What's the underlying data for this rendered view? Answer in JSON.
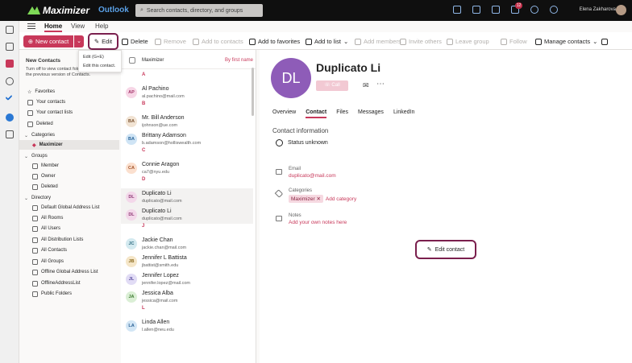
{
  "topbar": {
    "brand": "Maximizer",
    "app": "Outlook",
    "search_placeholder": "Search contacts, directory, and groups",
    "notification_count": "12",
    "user_name": "Elena Zakharova"
  },
  "menu": {
    "tabs": [
      "Home",
      "View",
      "Help"
    ]
  },
  "toolbar": {
    "new_contact": "New contact",
    "edit": "Edit",
    "delete": "Delete",
    "remove": "Remove",
    "add_to_contacts": "Add to contacts",
    "add_to_favorites": "Add to favorites",
    "add_to_list": "Add to list",
    "add_members": "Add members",
    "invite_others": "Invite others",
    "leave_group": "Leave group",
    "follow": "Follow",
    "manage_contacts": "Manage contacts"
  },
  "tooltip": {
    "shortcut": "Edit (G+E)",
    "desc": "Edit this contact."
  },
  "sidebar": {
    "new_contacts_title": "New Contacts",
    "new_contacts_desc": "Turn off to view contact folders in the previous version of Contacts.",
    "items": [
      "Favorites",
      "Your contacts",
      "Your contact lists",
      "Deleted"
    ],
    "categories_header": "Categories",
    "categories": [
      "Maximizer"
    ],
    "groups_header": "Groups",
    "groups": [
      "Member",
      "Owner",
      "Deleted"
    ],
    "directory_header": "Directory",
    "directory": [
      "Default Global Address List",
      "All Rooms",
      "All Users",
      "All Distribution Lists",
      "All Contacts",
      "All Groups",
      "Offline Global Address List",
      "OfflineAddressList",
      "Public Folders"
    ]
  },
  "list": {
    "header": "Maximizer",
    "sort": "By first name",
    "entries": [
      {
        "letter": "A"
      },
      {
        "initials": "AP",
        "name": "Al Pachino",
        "email": "al.pachino@mail.com",
        "color": "#f7d6e6",
        "fg": "#a4366b"
      },
      {
        "letter": "B"
      },
      {
        "initials": "BA",
        "name": "Mr. Bill Anderson",
        "email": "ijohnson@ue.com",
        "color": "#f1e3d3",
        "fg": "#7a5230"
      },
      {
        "initials": "BA",
        "name": "Brittany Adamson",
        "email": "b.adamson@holliswealth.com",
        "color": "#cfe4f5",
        "fg": "#2a6599"
      },
      {
        "letter": "C"
      },
      {
        "initials": "CA",
        "name": "Connie Aragon",
        "email": "ca7@nyu.edu",
        "color": "#fbe0cf",
        "fg": "#a3542a"
      },
      {
        "letter": "D"
      },
      {
        "initials": "DL",
        "name": "Duplicato Li",
        "email": "duplicato@mail.com",
        "color": "#f3d8ea",
        "fg": "#8e3a75"
      },
      {
        "initials": "DL",
        "name": "Duplicato Li",
        "email": "duplicato@mail.com",
        "color": "#f3d8ea",
        "fg": "#8e3a75"
      },
      {
        "letter": "J"
      },
      {
        "initials": "JC",
        "name": "Jackie Chan",
        "email": "jackie.chan@mail.com",
        "color": "#d4eaf0",
        "fg": "#2f6d80"
      },
      {
        "initials": "JB",
        "name": "Jennifer L Battista",
        "email": "jbattist@smith.edu",
        "color": "#f5e6c8",
        "fg": "#8a6a1f"
      },
      {
        "initials": "JL",
        "name": "Jennifer Lopez",
        "email": "jennifer.lopez@mail.com",
        "color": "#e1dcf5",
        "fg": "#5a4b9e"
      },
      {
        "initials": "JA",
        "name": "Jessica Alba",
        "email": "jessica@mail.com",
        "color": "#dbefd6",
        "fg": "#3d7a30"
      },
      {
        "letter": "L"
      },
      {
        "initials": "LA",
        "name": "Linda Allen",
        "email": "l.allen@neu.edu",
        "color": "#d3e6f5",
        "fg": "#2d6396"
      }
    ]
  },
  "detail": {
    "initials": "DL",
    "name": "Duplicato Li",
    "call": "Call",
    "tabs": [
      "Overview",
      "Contact",
      "Files",
      "Messages",
      "LinkedIn"
    ],
    "section": "Contact information",
    "status": "Status unknown",
    "email_label": "Email",
    "email": "duplicato@mail.com",
    "categories_label": "Categories",
    "category_tag": "Maximizer",
    "add_category": "Add category",
    "notes_label": "Notes",
    "notes_placeholder": "Add your own notes here",
    "edit_contact": "Edit contact"
  },
  "colors": {
    "accent": "#c8385a",
    "highlight": "#7a1f4d",
    "avatar": "#8e5cb8"
  }
}
